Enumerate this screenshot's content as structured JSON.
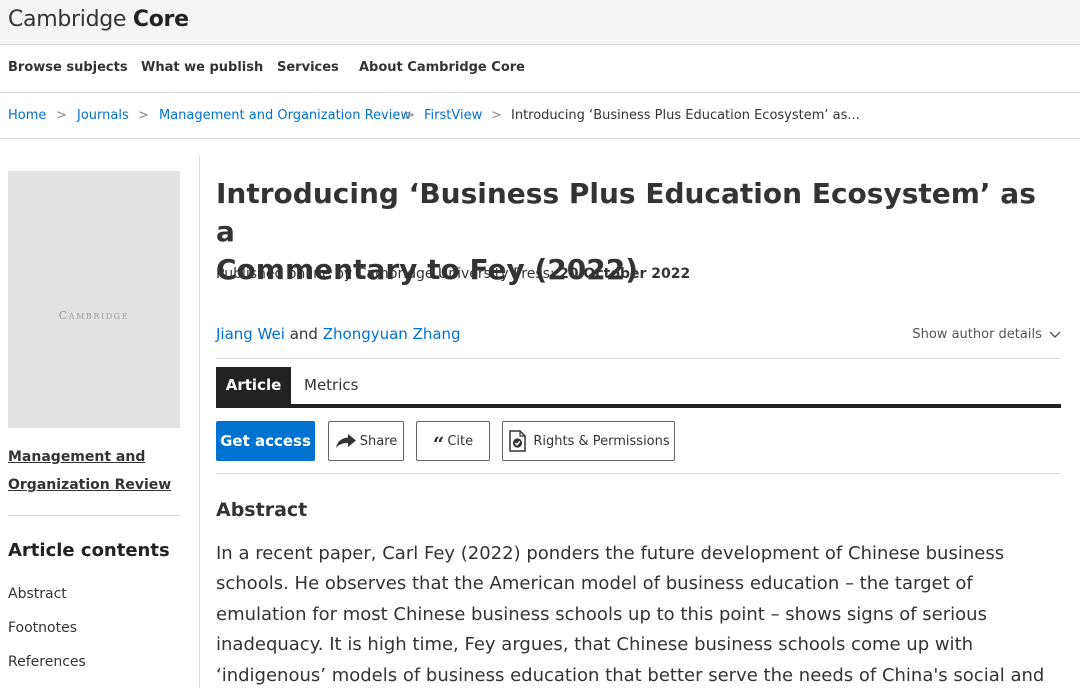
{
  "header": {
    "logo_text": "Cambridge",
    "logo_bold": "Core"
  },
  "nav": {
    "items": [
      "Browse subjects",
      "What we publish",
      "Services",
      "About Cambridge Core"
    ]
  },
  "breadcrumb": {
    "items": [
      "Home",
      "Journals",
      "Management and Organization Review",
      "FirstView"
    ],
    "separator": ">",
    "current": "Introducing ‘Business Plus Education Ecosystem’ as..."
  },
  "sidebar": {
    "cover_text": "Cambridge",
    "journal_line1": "Management and",
    "journal_line2": "Organization Review",
    "contents_heading": "Article contents",
    "toc": [
      "Abstract",
      "Footnotes",
      "References"
    ]
  },
  "article": {
    "title_line1": "Introducing ‘Business Plus Education Ecosystem’ as a",
    "title_line2": "Commentary to Fey (2022)",
    "published_label": "Published online by Cambridge University Press:",
    "published_date": "20 October 2022",
    "authors": [
      "Jiang Wei",
      "Zhongyuan Zhang"
    ],
    "authors_conjunction": "and",
    "show_author_details": "Show author details"
  },
  "tabs": [
    "Article",
    "Metrics"
  ],
  "actions": {
    "get_access": "Get access",
    "share": "Share",
    "cite": "Cite",
    "rights": "Rights & Permissions"
  },
  "abstract": {
    "heading": "Abstract",
    "lines": [
      "In a recent paper, Carl Fey (2022) ponders the future development of Chinese business",
      "schools. He observes that the American model of business education – the target of",
      "emulation for most Chinese business schools up to this point – shows signs of serious",
      "inadequacy. It is high time, Fey argues, that Chinese business schools come up with",
      "‘indigenous’ models of business education that better serve the needs of China's social and"
    ]
  },
  "colors": {
    "link": "#0072cf",
    "primary_button": "#0072cf",
    "tab_active": "#222222"
  },
  "icons": {
    "share": "share-arrow-icon",
    "cite": "quote-icon",
    "rights": "document-check-icon",
    "chevron": "chevron-down-icon"
  }
}
